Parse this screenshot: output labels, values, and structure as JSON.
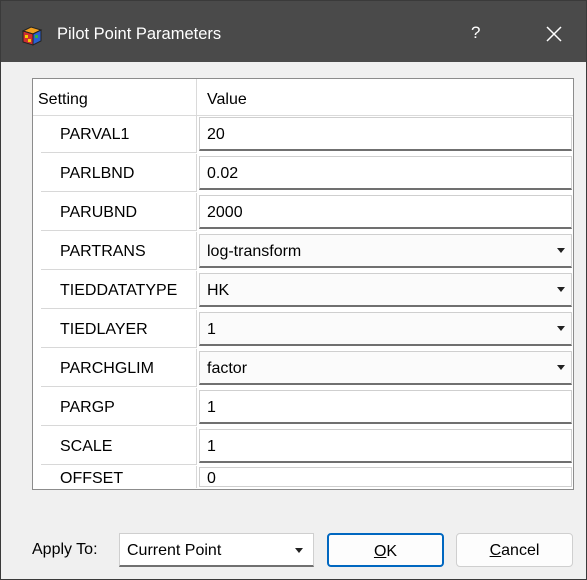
{
  "window": {
    "title": "Pilot Point Parameters",
    "help_label": "?"
  },
  "grid": {
    "headers": {
      "setting": "Setting",
      "value": "Value"
    },
    "rows": [
      {
        "setting": "PARVAL1",
        "value": "20",
        "type": "text"
      },
      {
        "setting": "PARLBND",
        "value": "0.02",
        "type": "text"
      },
      {
        "setting": "PARUBND",
        "value": "2000",
        "type": "text"
      },
      {
        "setting": "PARTRANS",
        "value": "log-transform",
        "type": "dropdown"
      },
      {
        "setting": "TIEDDATATYPE",
        "value": "HK",
        "type": "dropdown"
      },
      {
        "setting": "TIEDLAYER",
        "value": "1",
        "type": "dropdown"
      },
      {
        "setting": "PARCHGLIM",
        "value": "factor",
        "type": "dropdown"
      },
      {
        "setting": "PARGP",
        "value": "1",
        "type": "text"
      },
      {
        "setting": "SCALE",
        "value": "1",
        "type": "text"
      },
      {
        "setting": "OFFSET",
        "value": "0",
        "type": "text"
      }
    ]
  },
  "footer": {
    "apply_label": "Apply To:",
    "apply_value": "Current Point",
    "ok_mnemonic": "O",
    "ok_rest": "K",
    "cancel_mnemonic": "C",
    "cancel_rest": "ancel"
  },
  "colors": {
    "titlebar": "#4a4a4a",
    "ok_border": "#0067c0"
  }
}
